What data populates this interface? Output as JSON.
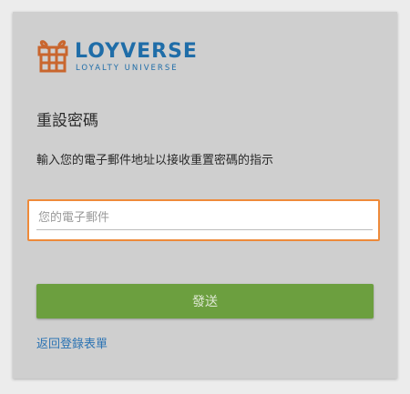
{
  "brand": {
    "name": "LOYVERSE",
    "tagline": "LOYALTY UNIVERSE",
    "logo_icon": "gift-box-icon",
    "logo_color": "#c9662e",
    "text_color": "#1f6da8"
  },
  "form": {
    "title": "重設密碼",
    "instructions": "輸入您的電子郵件地址以接收重置密碼的指示",
    "email": {
      "value": "",
      "placeholder": "您的電子郵件"
    },
    "send_label": "發送",
    "back_link": "返回登錄表單"
  },
  "colors": {
    "focus_border": "#ee8a3a",
    "button": "#6c9f3f",
    "link": "#2b73b3"
  }
}
